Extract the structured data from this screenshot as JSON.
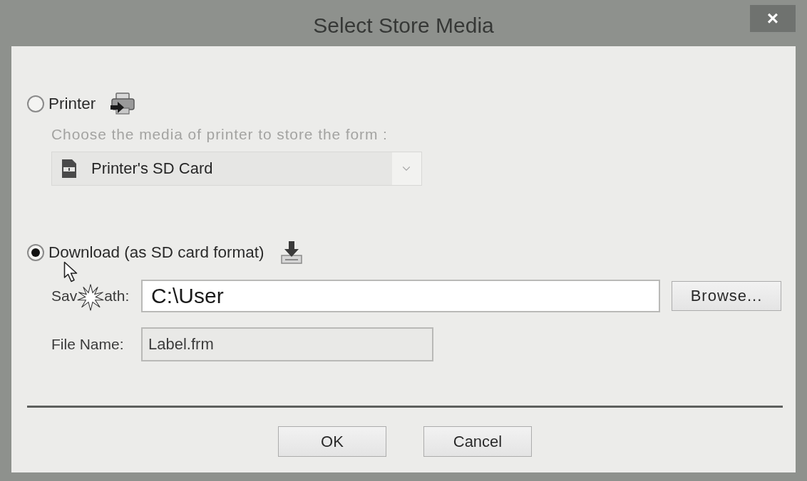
{
  "window": {
    "title": "Select Store Media",
    "close": "×"
  },
  "options": [
    {
      "kind": "printer",
      "label": "Printer",
      "selected": false,
      "hint": "Choose the media of printer to store the form :",
      "media": {
        "value": "Printer's SD Card"
      }
    },
    {
      "kind": "download",
      "label": "Download (as SD card format)",
      "selected": true,
      "fields": [
        {
          "kind": "path",
          "label": [
            "Sav",
            "ath:"
          ],
          "value": "C:\\User",
          "disabled": false,
          "button": "Browse..."
        },
        {
          "kind": "name",
          "label": [
            "File Name:"
          ],
          "value": "Label.frm",
          "disabled": true
        }
      ]
    }
  ],
  "buttons": [
    {
      "label": "OK"
    },
    {
      "label": "Cancel"
    }
  ]
}
